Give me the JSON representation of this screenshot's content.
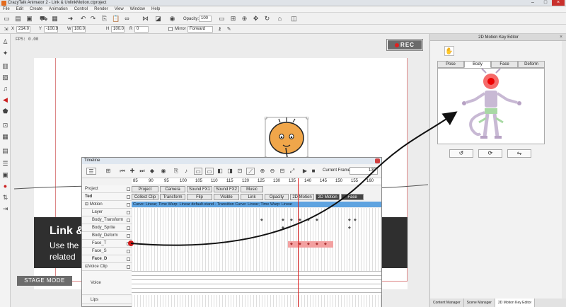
{
  "window": {
    "title": "CrazyTalk Animator 2  -  Link & UnlinkMotion.ctproject"
  },
  "menu": [
    "File",
    "Edit",
    "Create",
    "Animation",
    "Control",
    "Render",
    "View",
    "Window",
    "Help"
  ],
  "toolbar2": {
    "x_label": "X",
    "x_value": "214.0",
    "y_label": "Y",
    "y_value": "-100.9",
    "w_label": "W",
    "w_value": "100.0",
    "h_label": "H",
    "h_value": "100.0",
    "r_label": "R",
    "r_value": "0",
    "mirror_label": "Mirror",
    "facing_value": "Forward"
  },
  "opacity": {
    "label": "Opacity:",
    "value": "100"
  },
  "stage": {
    "fps": "FPS: 0.00",
    "rec_label": "REC",
    "banner_title": "Link &",
    "banner_line1": "Use the",
    "banner_line2": "related",
    "stage_mode_label": "STAGE MODE"
  },
  "timeline": {
    "title": "Timeline",
    "current_frame_label": "Current Frame:",
    "current_frame_value": "139",
    "ruler": [
      "85",
      "90",
      "95",
      "100",
      "105",
      "110",
      "115",
      "120",
      "125",
      "130",
      "135",
      "140",
      "145",
      "150",
      "155",
      "160"
    ],
    "project_label": "Project",
    "project_buttons": [
      "Project",
      "Camera",
      "Sound FX1",
      "Sound FX2",
      "Music"
    ],
    "ted_label": "Ted",
    "ted_buttons": [
      "Collect Clip",
      "Transform",
      "Flip",
      "Visible",
      "Link",
      "Opacity",
      "2D Motion",
      "2D Motion",
      "Face"
    ],
    "motion_label": "Motion",
    "motion_clip_text": "Curve: Linear; Time Warp: Linear                                   default-stand - Transition Curve: Linear; Time Warp: Linear",
    "tracks": [
      "Layer",
      "Body_Transform",
      "Body_Sprite",
      "Body_Deform",
      "Face_T",
      "Face_S",
      "Face_D"
    ],
    "voice_clip_label": "Voice Clip",
    "voice_label": "Voice",
    "lips_label": "Lips"
  },
  "right_panel": {
    "title": "2D Motion Key Editor",
    "tabs": [
      "Pose",
      "Body",
      "Face",
      "Deform"
    ],
    "active_tab": "Body",
    "bottom_tabs": [
      "Content Manager",
      "Scene Manager",
      "2D Motion Key Editor"
    ]
  },
  "colors": {
    "rec_dot": "#e02020",
    "timeline_playhead": "#e02020",
    "motion_clip": "#5ea3e0",
    "face_clip": "#f3a0a0"
  }
}
